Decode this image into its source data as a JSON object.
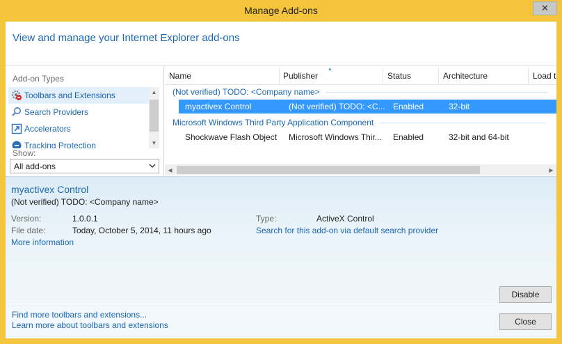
{
  "window": {
    "title": "Manage Add-ons",
    "close_glyph": "✕"
  },
  "header": {
    "text": "View and manage your Internet Explorer add-ons"
  },
  "sidebar": {
    "label": "Add-on Types",
    "items": [
      {
        "label": "Toolbars and Extensions",
        "icon": "gear-icon"
      },
      {
        "label": "Search Providers",
        "icon": "search-icon"
      },
      {
        "label": "Accelerators",
        "icon": "accelerator-icon"
      },
      {
        "label": "Tracking Protection",
        "icon": "tracking-protection-icon"
      }
    ],
    "show_label": "Show:",
    "show_value": "All add-ons"
  },
  "list": {
    "columns": [
      "Name",
      "Publisher",
      "Status",
      "Architecture",
      "Load t"
    ],
    "groups": [
      {
        "name": "(Not verified) TODO: <Company name>",
        "rows": [
          {
            "name": "myactivex Control",
            "publisher": "(Not verified) TODO: <C...",
            "status": "Enabled",
            "architecture": "32-bit"
          }
        ]
      },
      {
        "name": "Microsoft Windows Third Party Application Component",
        "rows": [
          {
            "name": "Shockwave Flash Object",
            "publisher": "Microsoft Windows Thir...",
            "status": "Enabled",
            "architecture": "32-bit and 64-bit"
          }
        ]
      }
    ]
  },
  "details": {
    "name": "myactivex Control",
    "publisher": "(Not verified) TODO: <Company name>",
    "version_label": "Version:",
    "version_value": "1.0.0.1",
    "file_date_label": "File date:",
    "file_date_value": "Today, October 5, 2014, 11 hours ago",
    "more_info": "More information",
    "type_label": "Type:",
    "type_value": "ActiveX Control",
    "search_link": "Search for this add-on via default search provider",
    "disable_button": "Disable"
  },
  "footer": {
    "link1": "Find more toolbars and extensions...",
    "link2": "Learn more about toolbars and extensions",
    "close_button": "Close"
  },
  "colors": {
    "accent": "#1b68b3",
    "selection": "#3399ff",
    "titlebar": "#f4c43b"
  }
}
